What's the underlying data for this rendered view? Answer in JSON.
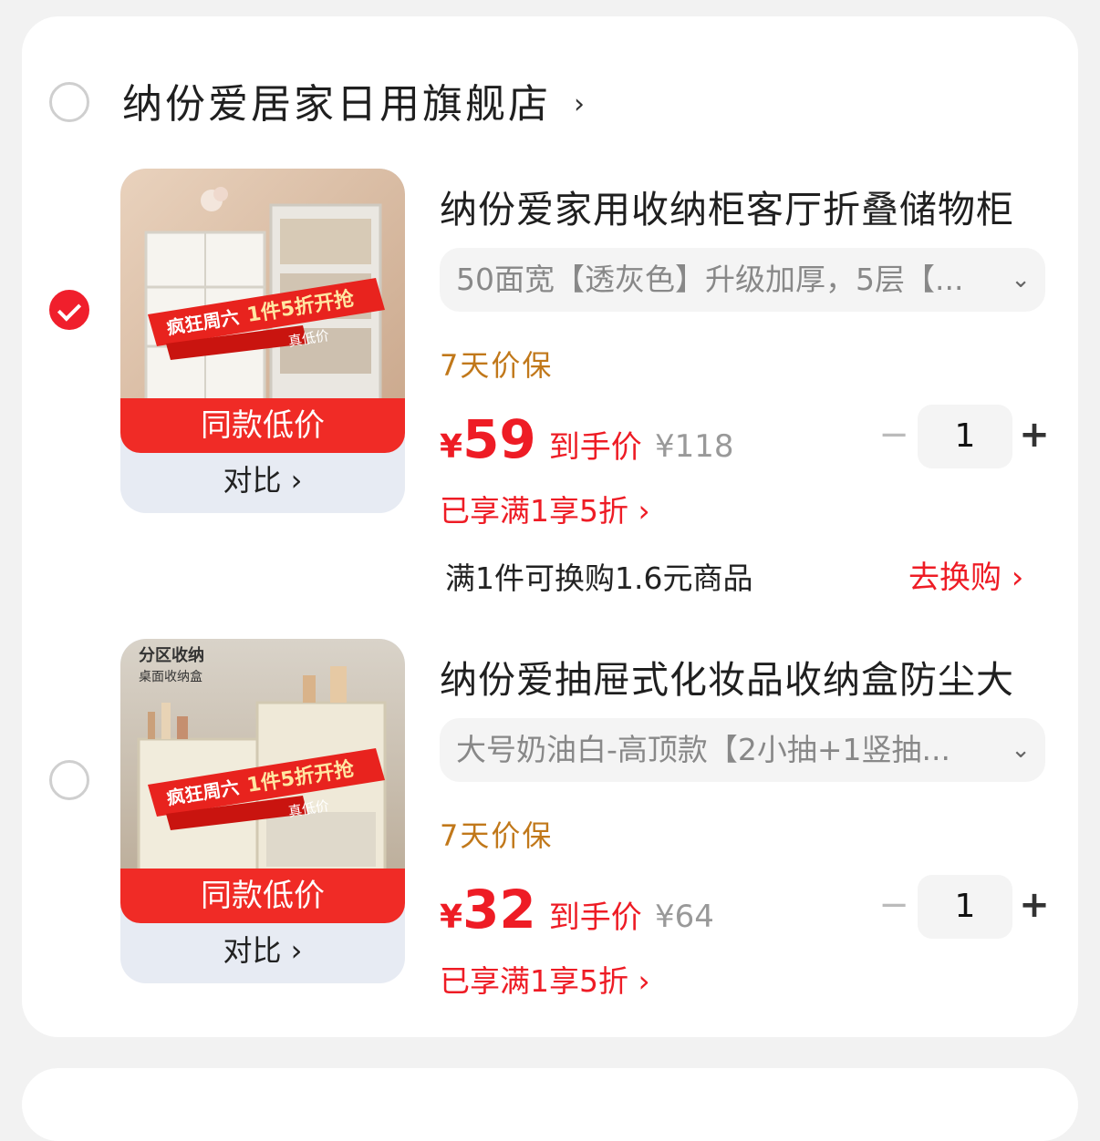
{
  "colors": {
    "accent": "#ee1c25",
    "guarantee": "#c1781a"
  },
  "store": {
    "name": "纳份爱居家日用旗舰店",
    "chevron": "›",
    "selected": false
  },
  "items": [
    {
      "selected": true,
      "image_badge": "疯狂周六 1件5折开抢 真低价",
      "low_price_label": "同款低价",
      "compare_label": "对比 ›",
      "title": "纳份爱家用收纳柜客厅折叠储物柜",
      "spec": "50面宽【透灰色】升级加厚，5层【...",
      "spec_icon": "chevron-down-icon",
      "guarantee": "7天价保",
      "currency": "¥",
      "price": "59",
      "price_label": "到手价",
      "original_price": "¥118",
      "quantity": "1",
      "minus": "−",
      "plus": "+",
      "promo": "已享满1享5折 ›",
      "exchange_text": "满1件可换购1.6元商品",
      "exchange_link": "去换购 ›"
    },
    {
      "selected": false,
      "image_badge_top": "分区收纳 桌面收纳盒",
      "image_badge": "疯狂周六 1件5折开抢 真低价",
      "low_price_label": "同款低价",
      "compare_label": "对比 ›",
      "title": "纳份爱抽屉式化妆品收纳盒防尘大",
      "spec": "大号奶油白-高顶款【2小抽+1竖抽...",
      "spec_icon": "chevron-down-icon",
      "guarantee": "7天价保",
      "currency": "¥",
      "price": "32",
      "price_label": "到手价",
      "original_price": "¥64",
      "quantity": "1",
      "minus": "−",
      "plus": "+",
      "promo": "已享满1享5折 ›"
    }
  ]
}
